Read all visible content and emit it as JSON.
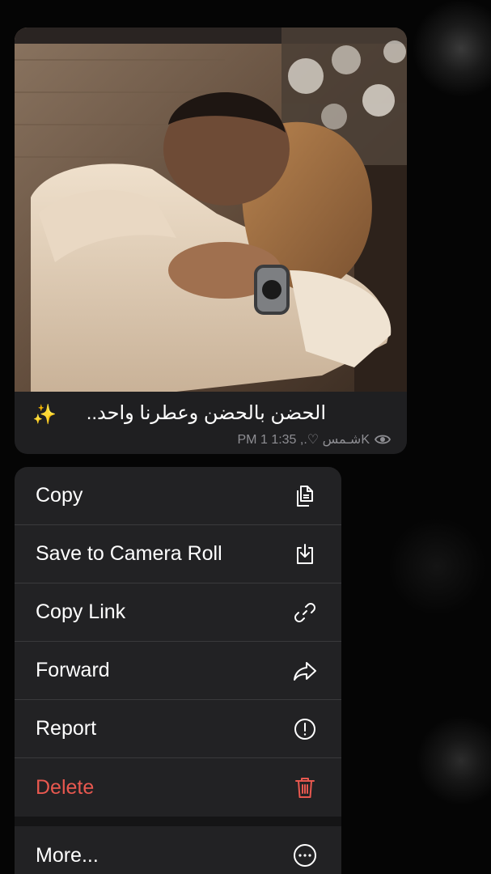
{
  "message": {
    "caption": "الحضن بالحضن وعطرنا واحد..",
    "caption_emoji": "✨",
    "views": "1K",
    "time": "1:35 PM",
    "author": "شـمس ♡.,",
    "meta_text": "PM شـمس ♡.,  1:35 1K",
    "photo_icon": "photo-hug"
  },
  "menu": {
    "items": [
      {
        "label": "Copy",
        "icon": "copy-icon"
      },
      {
        "label": "Save to Camera Roll",
        "icon": "download-icon"
      },
      {
        "label": "Copy Link",
        "icon": "link-icon"
      },
      {
        "label": "Forward",
        "icon": "forward-icon"
      },
      {
        "label": "Report",
        "icon": "report-icon"
      },
      {
        "label": "Delete",
        "icon": "trash-icon"
      },
      {
        "label": "More...",
        "icon": "more-icon"
      }
    ]
  },
  "colors": {
    "menu_bg": "#222224",
    "bubble_bg": "#1f1f21",
    "danger": "#e8584f",
    "meta": "#8e8e93"
  }
}
